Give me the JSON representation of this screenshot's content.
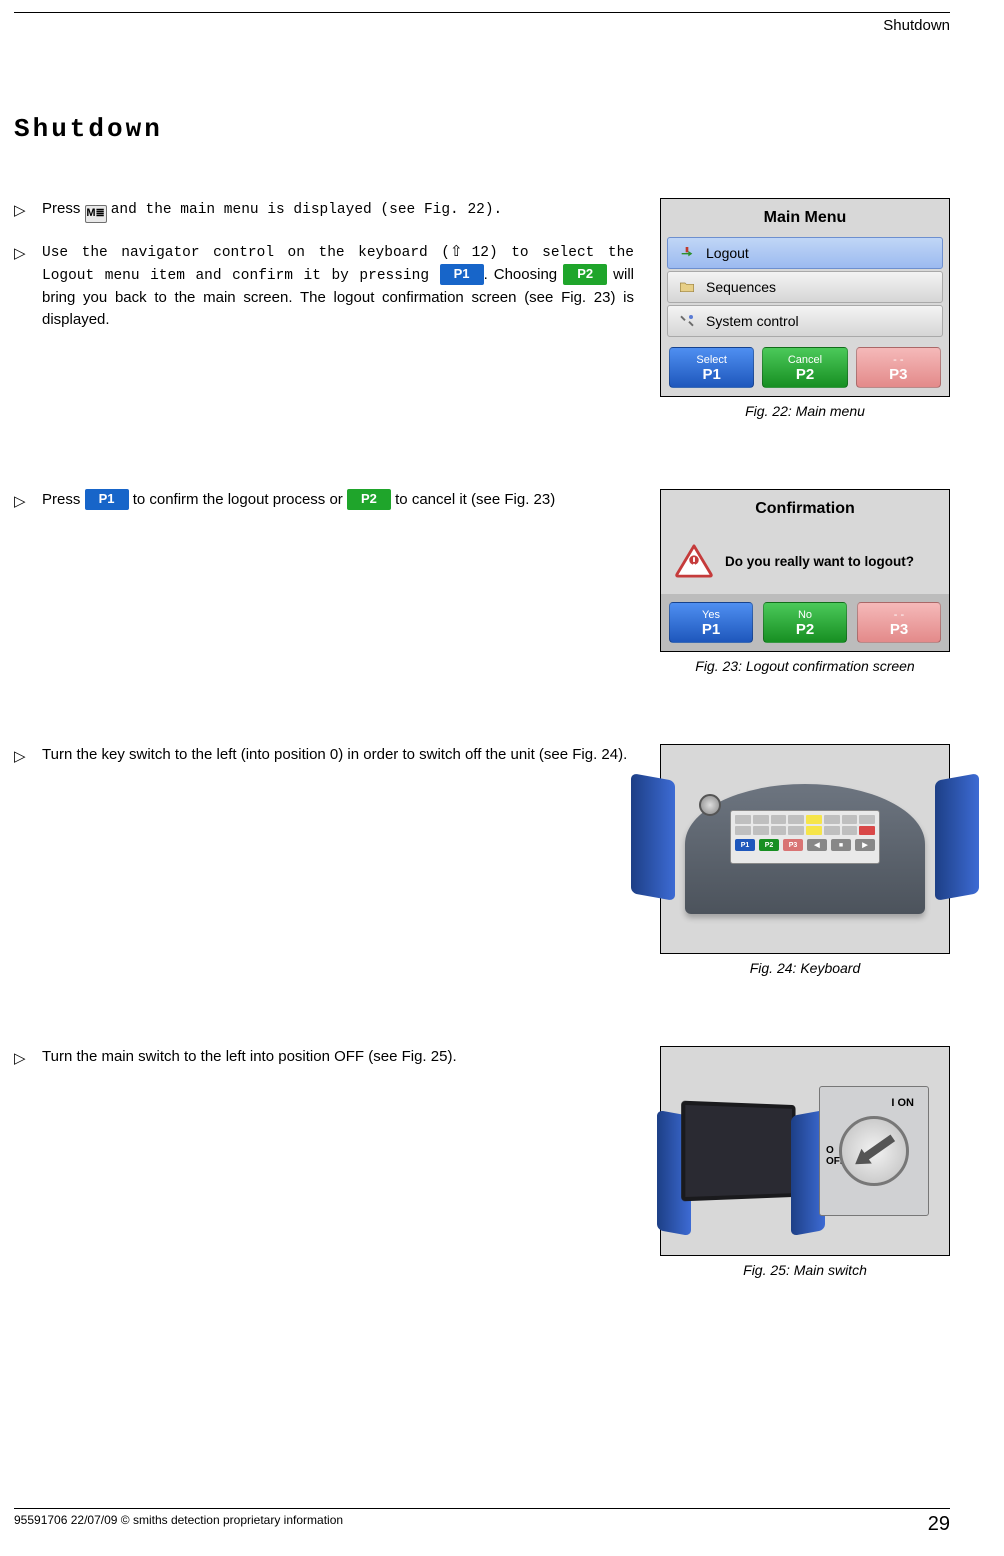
{
  "header": {
    "running": "Shutdown"
  },
  "title": "Shutdown",
  "step1": {
    "a": "Press ",
    "b": "and the main menu is displayed (see Fig. 22)."
  },
  "step2": {
    "a": "Use the navigator control on the keyboard (",
    "ref": "12",
    "b": ") to select the ",
    "c": "Logout menu item and confirm it by pressing ",
    "p1": "P1",
    "d": ". Choosing ",
    "p2": "P2",
    "e": " will bring you back to the main screen. The logout confirmation screen (see Fig. 23) is displayed."
  },
  "step3": {
    "a": "Press ",
    "p1": "P1",
    "b": " to confirm the logout process or ",
    "p2": "P2",
    "c": " to cancel it (see Fig. 23)"
  },
  "step4": "Turn the key switch to the left (into position 0) in order to switch off the unit (see Fig. 24).",
  "step5": "Turn the main switch to the left into position OFF (see Fig. 25).",
  "fig22": {
    "caption": "Fig. 22: Main menu",
    "title": "Main Menu",
    "items": [
      "Logout",
      "Sequences",
      "System control"
    ],
    "buttons": [
      {
        "small": "Select",
        "big": "P1"
      },
      {
        "small": "Cancel",
        "big": "P2"
      },
      {
        "small": "- -",
        "big": "P3"
      }
    ]
  },
  "fig23": {
    "caption": "Fig. 23: Logout confirmation screen",
    "title": "Confirmation",
    "message": "Do you really want to logout?",
    "buttons": [
      {
        "small": "Yes",
        "big": "P1"
      },
      {
        "small": "No",
        "big": "P2"
      },
      {
        "small": "- -",
        "big": "P3"
      }
    ]
  },
  "fig24": {
    "caption": "Fig. 24: Keyboard"
  },
  "fig25": {
    "caption": "Fig. 25: Main switch",
    "on": "I ON",
    "off_o": "O",
    "off": "OFF"
  },
  "footer": {
    "left": "95591706 22/07/09 © smiths detection proprietary information",
    "page": "29"
  }
}
